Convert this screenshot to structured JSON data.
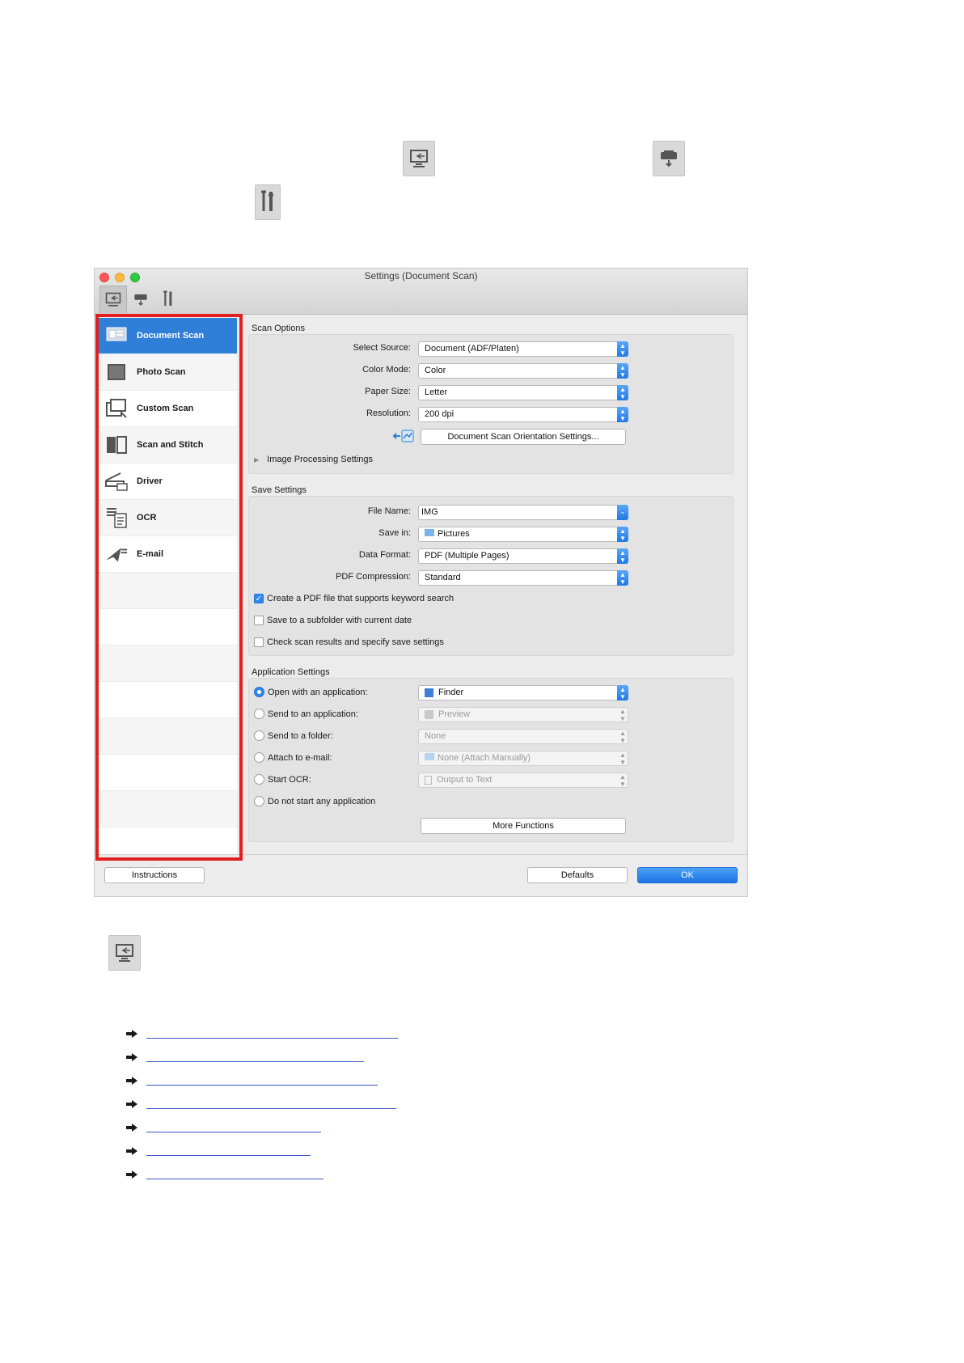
{
  "window": {
    "title": "Settings (Document Scan)",
    "toolbar_tabs": [
      "scan-from-computer-tab",
      "scan-from-operation-panel-tab",
      "general-settings-tab"
    ]
  },
  "sidebar": {
    "items": [
      {
        "label": "Document Scan",
        "icon": "document-scan-icon"
      },
      {
        "label": "Photo Scan",
        "icon": "photo-scan-icon"
      },
      {
        "label": "Custom Scan",
        "icon": "custom-scan-icon"
      },
      {
        "label": "Scan and Stitch",
        "icon": "scan-stitch-icon"
      },
      {
        "label": "Driver",
        "icon": "driver-icon"
      },
      {
        "label": "OCR",
        "icon": "ocr-icon"
      },
      {
        "label": "E-mail",
        "icon": "email-icon"
      }
    ]
  },
  "scan_options": {
    "title": "Scan Options",
    "select_source_label": "Select Source:",
    "select_source_value": "Document (ADF/Platen)",
    "color_mode_label": "Color Mode:",
    "color_mode_value": "Color",
    "paper_size_label": "Paper Size:",
    "paper_size_value": "Letter",
    "resolution_label": "Resolution:",
    "resolution_value": "200 dpi",
    "orientation_button": "Document Scan Orientation Settings...",
    "image_processing": "Image Processing Settings"
  },
  "save_settings": {
    "title": "Save Settings",
    "file_name_label": "File Name:",
    "file_name_value": "IMG",
    "save_in_label": "Save in:",
    "save_in_value": "Pictures",
    "data_format_label": "Data Format:",
    "data_format_value": "PDF (Multiple Pages)",
    "pdf_compression_label": "PDF Compression:",
    "pdf_compression_value": "Standard",
    "check_keyword": "Create a PDF file that supports keyword search",
    "check_subfolder": "Save to a subfolder with current date",
    "check_results": "Check scan results and specify save settings"
  },
  "application_settings": {
    "title": "Application Settings",
    "open_app_label": "Open with an application:",
    "open_app_value": "Finder",
    "send_app_label": "Send to an application:",
    "send_app_value": "Preview",
    "send_folder_label": "Send to a folder:",
    "send_folder_value": "None",
    "attach_email_label": "Attach to e-mail:",
    "attach_email_value": "None (Attach Manually)",
    "start_ocr_label": "Start OCR:",
    "start_ocr_value": "Output to Text",
    "no_app_label": "Do not start any application",
    "more_functions": "More Functions"
  },
  "footer": {
    "instructions": "Instructions",
    "defaults": "Defaults",
    "ok": "OK"
  },
  "colors": {
    "accent": "#2f7fd8",
    "highlight_frame": "#e21f1f",
    "link": "#3a55c9"
  }
}
